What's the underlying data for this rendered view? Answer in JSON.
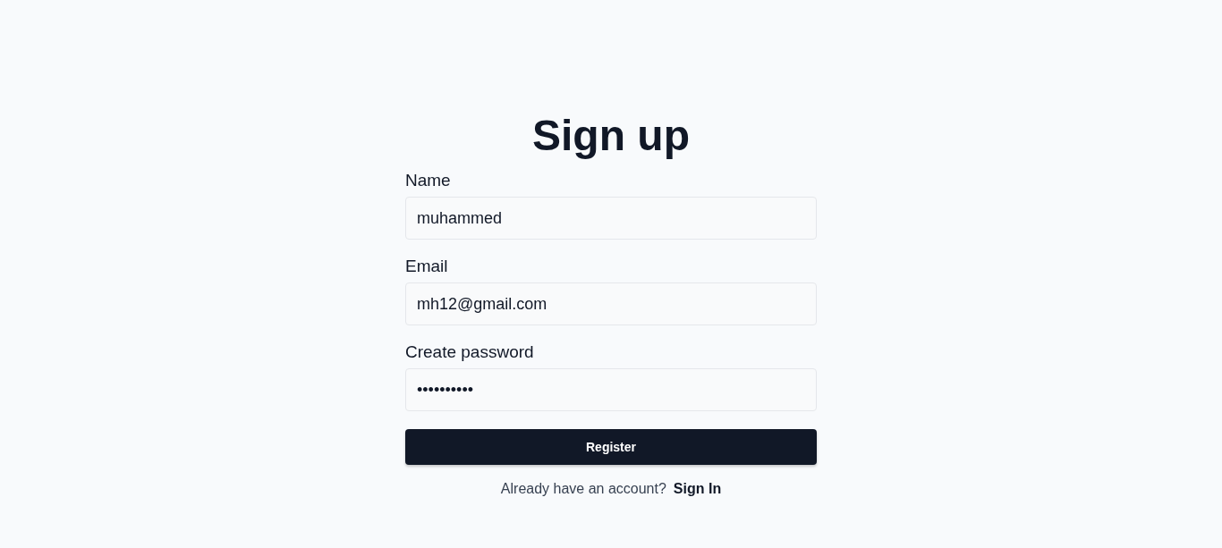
{
  "title": "Sign up",
  "fields": [
    {
      "label": "Name",
      "value": "muhammed"
    },
    {
      "label": "Email",
      "value": "mh12@gmail.com"
    },
    {
      "label": "Create password",
      "value": "••••••••••"
    }
  ],
  "button": "Register",
  "footer": {
    "text": "Already have an account?",
    "link": "Sign In"
  }
}
